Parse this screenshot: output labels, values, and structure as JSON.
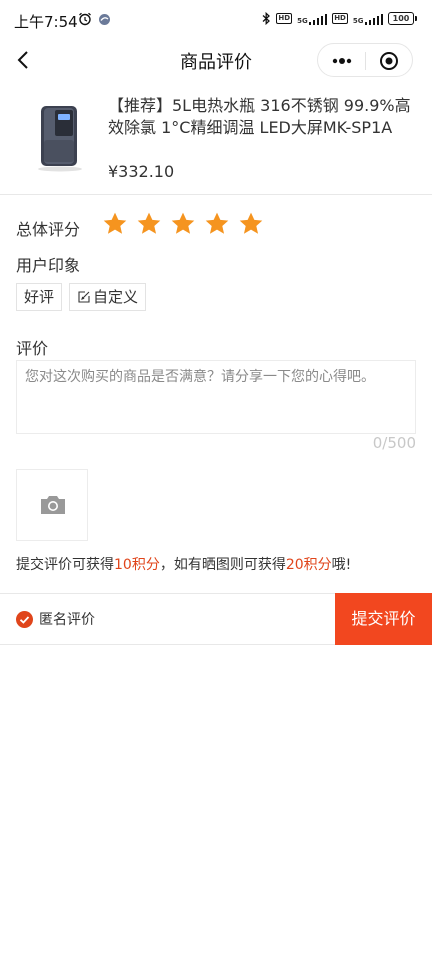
{
  "status_bar": {
    "time": "上午7:54",
    "network_1": "5G",
    "network_2": "5G",
    "battery": "100"
  },
  "nav": {
    "title": "商品评价"
  },
  "product": {
    "name": "【推荐】5L电热水瓶 316不锈钢 99.9%高效除氯 1°C精细调温 LED大屏MK-SP1A",
    "price": "¥332.10"
  },
  "rating": {
    "label": "总体评分",
    "stars": 5,
    "max_stars": 5,
    "star_color": "#f5941f"
  },
  "impression": {
    "label": "用户印象",
    "tags": [
      "好评",
      "自定义"
    ]
  },
  "review": {
    "label": "评价",
    "placeholder": "您对这次购买的商品是否满意？请分享一下您的心得吧。",
    "counter": "0/500"
  },
  "points_note": {
    "part1": "提交评价可获得",
    "points1": "10积分",
    "part2": "，如有晒图则可获得",
    "points2": "20积分",
    "part3": "哦!"
  },
  "bottom": {
    "anonymous_label": "匿名评价",
    "submit_label": "提交评价",
    "accent": "#f2471f"
  }
}
